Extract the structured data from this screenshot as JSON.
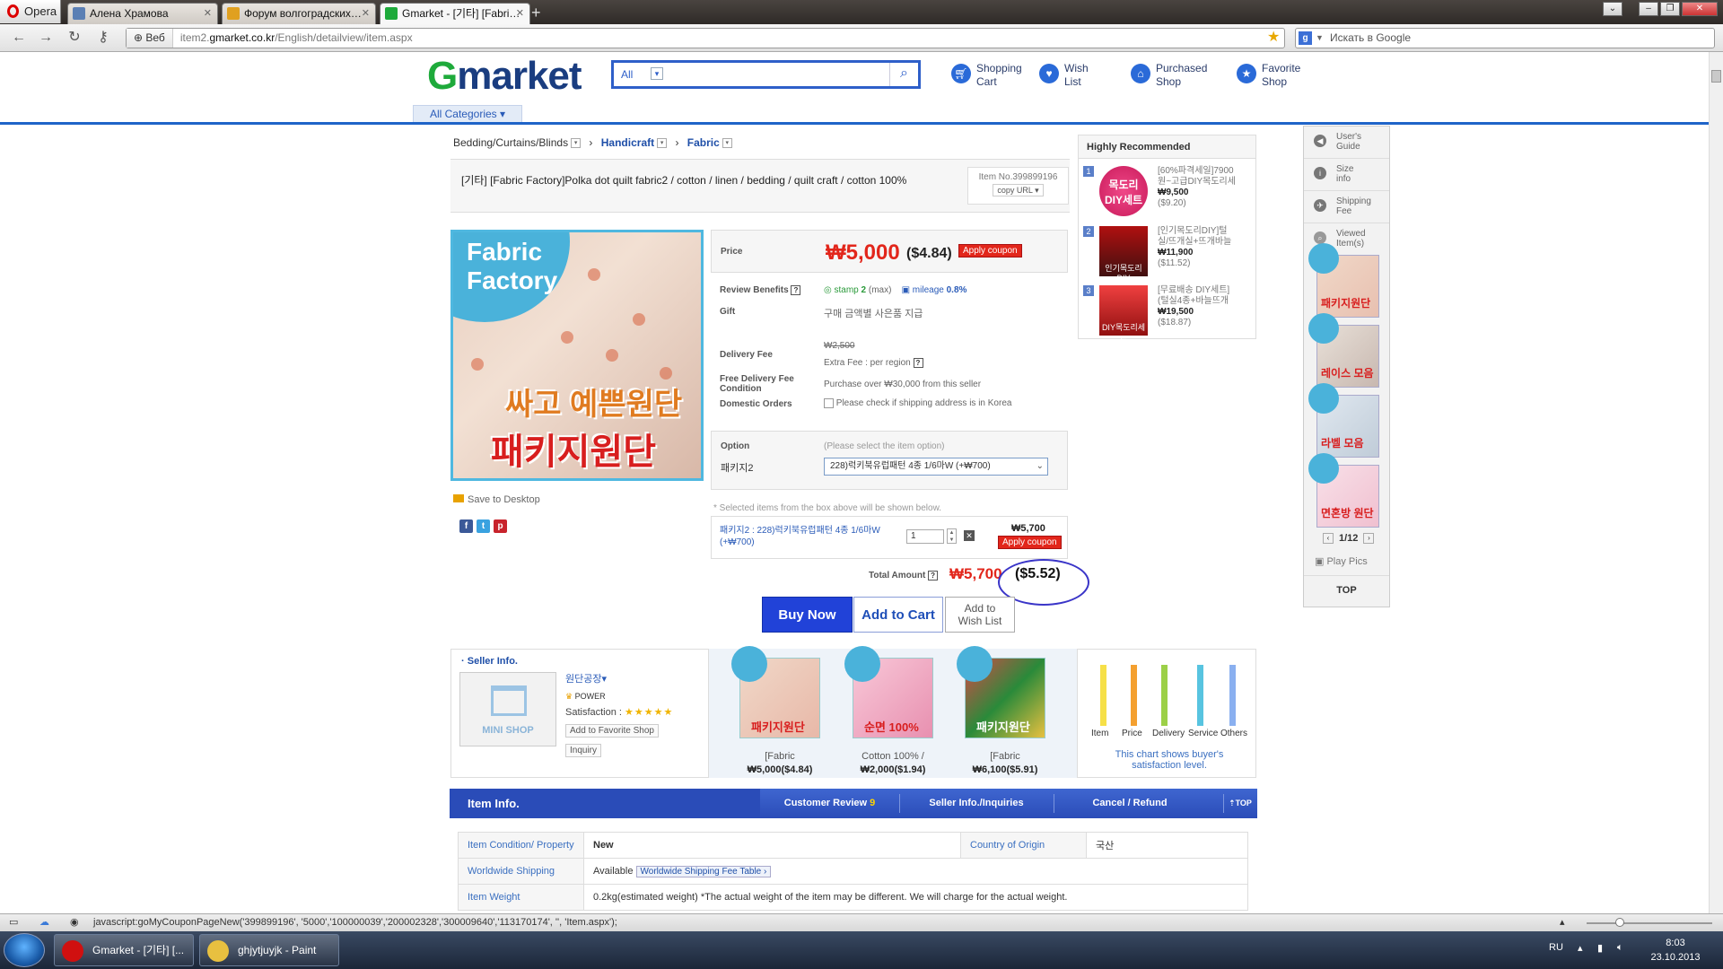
{
  "browser": {
    "menu_label": "Opera",
    "tabs": [
      {
        "title": "Алена Храмова",
        "favicon_color": "#5b7fb4"
      },
      {
        "title": "Форум волгоградских…",
        "favicon_color": "#e0a020"
      },
      {
        "title": "Gmarket - [기타] [Fabri…",
        "favicon_color": "#1eaa3b"
      }
    ],
    "web_label": "Веб",
    "url_prefix": "item2.",
    "url_domain": "gmarket.co.kr",
    "url_path": "/English/detailview/item.aspx",
    "search_placeholder": "Искать в Google",
    "search_engine_letter": "g"
  },
  "header": {
    "logo_g": "G",
    "logo_rest": "market",
    "search_category": "All",
    "links": [
      {
        "line1": "Shopping",
        "line2": "Cart",
        "icon": "cart-icon"
      },
      {
        "line1": "Wish",
        "line2": "List",
        "icon": "heart-icon"
      },
      {
        "line1": "Purchased",
        "line2": "Shop",
        "icon": "house-icon"
      },
      {
        "line1": "Favorite",
        "line2": "Shop",
        "icon": "star-icon"
      }
    ],
    "all_categories": "All Categories"
  },
  "breadcrumb": [
    "Bedding/Curtains/Blinds",
    "Handicraft",
    "Fabric"
  ],
  "product": {
    "title": "[기타] [Fabric Factory]Polka dot quilt fabric2 / cotton / linen / bedding / quilt craft / cotton 100%",
    "item_no": "Item No.399899196",
    "copy_url": "copy URL",
    "image_brand_line1": "Fabric",
    "image_brand_line2": "Factory",
    "image_text1": "싸고 예쁜원단",
    "image_text2": "패키지원단",
    "save_to_desktop": "Save to Desktop"
  },
  "pricing": {
    "price_label": "Price",
    "price_krw": "₩5,000",
    "price_usd": "($4.84)",
    "apply_coupon": "Apply coupon",
    "review_benefits_label": "Review Benefits",
    "stamp_label": "stamp",
    "stamp_value": "2",
    "stamp_max": "(max)",
    "mileage_label": "mileage",
    "mileage_value": "0.8%",
    "gift_label": "Gift",
    "gift_value": "구매 금액별 사은품 지급",
    "delivery_fee_label": "Delivery Fee",
    "delivery_fee_value": "₩2,500",
    "extra_fee": "Extra Fee : per region",
    "free_delivery_label_1": "Free Delivery Fee",
    "free_delivery_label_2": "Condition",
    "free_delivery_value": "Purchase over ₩30,000 from this seller",
    "domestic_label": "Domestic Orders",
    "domestic_value": "Please check if shipping address is in Korea"
  },
  "options": {
    "label": "Option",
    "hint": "(Please select the item option)",
    "option_name": "패키지2",
    "selected": "228)럭키북유럽패턴 4종 1/6마W (+₩700)",
    "note": "* Selected items from the box above will be shown below.",
    "selected_line1": "패키지2 : 228)럭키북유럽패턴 4종 1/6마W",
    "selected_line2": "(+₩700)",
    "quantity": "1",
    "line_price": "₩5,700",
    "line_coupon": "Apply coupon"
  },
  "total": {
    "label": "Total Amount",
    "krw": "₩5,700",
    "usd": "($5.52)"
  },
  "actions": {
    "buy_now": "Buy Now",
    "add_to_cart": "Add to Cart",
    "wish_line1": "Add to",
    "wish_line2": "Wish List"
  },
  "recommended": {
    "heading": "Highly Recommended",
    "items": [
      {
        "num": "1",
        "name1": "[60%파격세일]7900",
        "name2": "원~고급DIY목도리세",
        "krw": "₩9,500",
        "usd": "($9.20)",
        "img_text": "목도리 DIY세트",
        "color": "#e83a7a"
      },
      {
        "num": "2",
        "name1": "[인기목도리DIY]털",
        "name2": "실/뜨개실+뜨개바늘",
        "krw": "₩11,900",
        "usd": "($11.52)",
        "img_text": "인기목도리 DIY",
        "color": "#c01818"
      },
      {
        "num": "3",
        "name1": "[무료배송 DIY세트]",
        "name2": "(털실4종+바늘뜨개",
        "krw": "₩19,500",
        "usd": "($18.87)",
        "img_text": "DIY목도리세트",
        "color": "#d82020"
      }
    ]
  },
  "sidebar": {
    "items": [
      {
        "line1": "User's",
        "line2": "Guide",
        "icon": "speaker-icon"
      },
      {
        "line1": "Size",
        "line2": "info",
        "icon": "info-icon"
      },
      {
        "line1": "Shipping",
        "line2": "Fee",
        "icon": "plane-icon"
      },
      {
        "line1": "Viewed",
        "line2": "Item(s)",
        "icon": "magnifier-icon"
      }
    ],
    "thumbs": [
      "패키지원단",
      "레이스 모음",
      "라벨 모음",
      "면혼방 원단"
    ],
    "pager": "1/12",
    "play_pics": "Play Pics",
    "top": "TOP"
  },
  "seller": {
    "heading": "Seller Info.",
    "mini_shop": "MINI SHOP",
    "name": "원단공장",
    "power": "POWER",
    "satisfaction": "Satisfaction :",
    "stars": "★★★★★",
    "add_favorite": "Add to Favorite Shop",
    "inquiry": "Inquiry",
    "products": [
      {
        "name": "[Fabric",
        "price": "₩5,000($4.84)",
        "img_text": "패키지원단"
      },
      {
        "name": "Cotton 100% /",
        "price": "₩2,000($1.94)",
        "img_text": "순면 100%"
      },
      {
        "name": "[Fabric",
        "price": "₩6,100($5.91)",
        "img_text": "패키지원단"
      }
    ]
  },
  "chart_data": {
    "type": "bar",
    "categories": [
      "Item",
      "Price",
      "Delivery",
      "Service",
      "Others"
    ],
    "values": [
      95,
      95,
      95,
      95,
      95
    ],
    "colors": [
      "#f6e048",
      "#f4a030",
      "#9cd048",
      "#58c4e0",
      "#8ab0f0"
    ],
    "ylim": [
      0,
      100
    ],
    "note_line1": "This chart shows buyer's",
    "note_line2": "satisfaction level."
  },
  "info_tabs": {
    "item_info": "Item Info.",
    "customer_review": "Customer Review",
    "review_count": "9",
    "seller_inquiries": "Seller Info./Inquiries",
    "cancel_refund": "Cancel / Refund",
    "top": "TOP"
  },
  "info_table": {
    "condition_label": "Item Condition/ Property",
    "condition_value": "New",
    "origin_label": "Country of Origin",
    "origin_value": "국산",
    "shipping_label": "Worldwide Shipping",
    "shipping_value": "Available",
    "shipping_table": "Worldwide Shipping Fee Table",
    "weight_label": "Item Weight",
    "weight_value": "0.2kg(estimated weight) *The actual weight of the item may be different. We will charge for the actual weight."
  },
  "statusbar": {
    "link": "javascript:goMyCouponPageNew('399899196', '5000','100000039','200002328','300009640','113170174', '', 'Item.aspx');"
  },
  "taskbar": {
    "items": [
      {
        "title": "Gmarket - [기타] [...",
        "color": "#d01010"
      },
      {
        "title": "ghjytjuyjk - Paint",
        "color": "#e8c040"
      }
    ],
    "lang": "RU",
    "time": "8:03",
    "date": "23.10.2013"
  }
}
